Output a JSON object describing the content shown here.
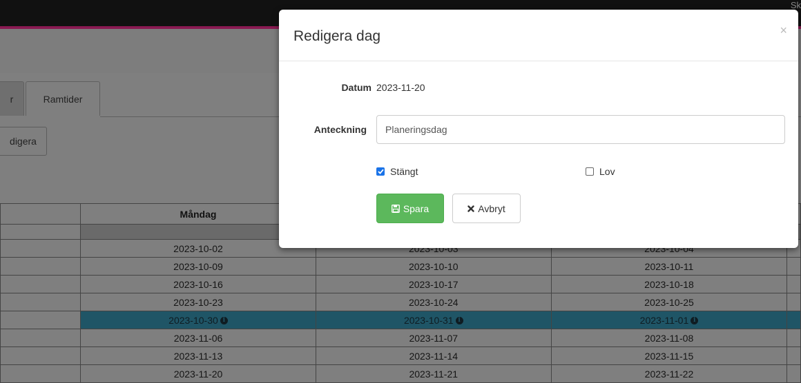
{
  "topbar": {
    "right_text": "Sk"
  },
  "tabs": [
    {
      "label": "r"
    },
    {
      "label": "Ramtider"
    }
  ],
  "toolbar": {
    "edit_label": "digera"
  },
  "calendar": {
    "headers": [
      "",
      "Måndag",
      "",
      ""
    ],
    "rows": [
      [
        "",
        "2023-10-02",
        "2023-10-03",
        "2023-10-04"
      ],
      [
        "",
        "2023-10-09",
        "2023-10-10",
        "2023-10-11"
      ],
      [
        "",
        "2023-10-16",
        "2023-10-17",
        "2023-10-18"
      ],
      [
        "",
        "2023-10-23",
        "2023-10-24",
        "2023-10-25"
      ],
      [
        "",
        "2023-10-30",
        "2023-10-31",
        "2023-11-01"
      ],
      [
        "",
        "2023-11-06",
        "2023-11-07",
        "2023-11-08"
      ],
      [
        "",
        "2023-11-13",
        "2023-11-14",
        "2023-11-15"
      ],
      [
        "",
        "2023-11-20",
        "2023-11-21",
        "2023-11-22"
      ]
    ],
    "highlight_row": 4,
    "highlight_color": "#1f5566"
  },
  "modal": {
    "title": "Redigera dag",
    "close_symbol": "×",
    "date_label": "Datum",
    "date_value": "2023-11-20",
    "note_label": "Anteckning",
    "note_value": "Planeringsdag",
    "closed_label": "Stängt",
    "closed_checked": true,
    "leave_label": "Lov",
    "leave_checked": false,
    "save_label": "Spara",
    "save_icon": "floppy-disk-icon",
    "save_color": "#5cb85c",
    "cancel_label": "Avbryt",
    "cancel_icon": "x-icon"
  }
}
